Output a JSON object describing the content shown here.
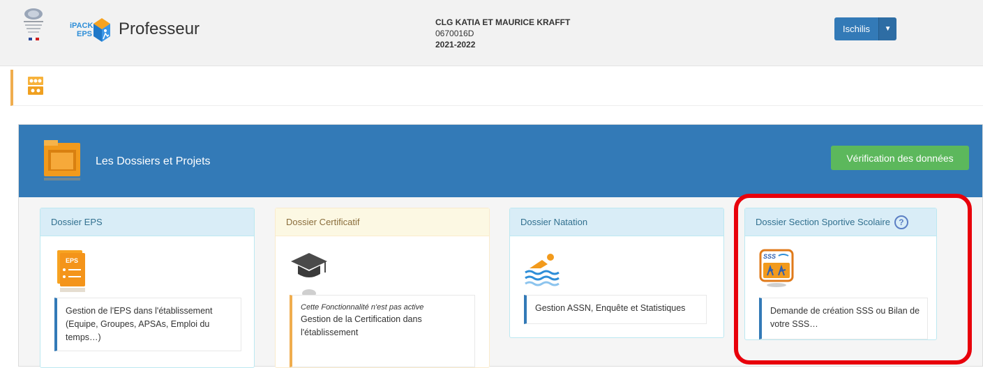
{
  "header": {
    "ipack_logo_text_top": "iPACK",
    "ipack_logo_text_bottom": "EPS",
    "app_title": "Professeur",
    "school_name": "CLG KATIA ET MAURICE KRAFFT",
    "school_code": "0670016D",
    "school_year": "2021-2022",
    "user_label": "Ischilis",
    "user_caret_icon": "caret-down-icon"
  },
  "toolbar": {
    "icon": "people-board-icon"
  },
  "panel": {
    "title": "Les Dossiers et Projets",
    "verify_button": "Vérification des données",
    "icon": "folder-icon"
  },
  "cards": [
    {
      "title": "Dossier EPS",
      "icon": "eps-files-icon",
      "icon_text": "EPS",
      "desc": "Gestion de l'EPS dans l'établissement (Equipe, Groupes, APSAs, Emploi du temps…)"
    },
    {
      "title": "Dossier Certificatif",
      "icon": "graduation-cap-icon",
      "note": "Cette Fonctionnalité n'est pas active",
      "desc": "Gestion de la Certification dans l'établissement"
    },
    {
      "title": "Dossier Natation",
      "icon": "swimmer-icon",
      "desc": "Gestion ASSN, Enquête et Statistiques"
    },
    {
      "title": "Dossier Section Sportive Scolaire",
      "help": "?",
      "icon": "sss-icon",
      "icon_text": "SSS",
      "desc": "Demande de création SSS ou Bilan de votre SSS…"
    }
  ],
  "colors": {
    "primary": "#337ab7",
    "success": "#5cb85c",
    "warning": "#f0ad4e",
    "highlight": "#e8000b"
  }
}
